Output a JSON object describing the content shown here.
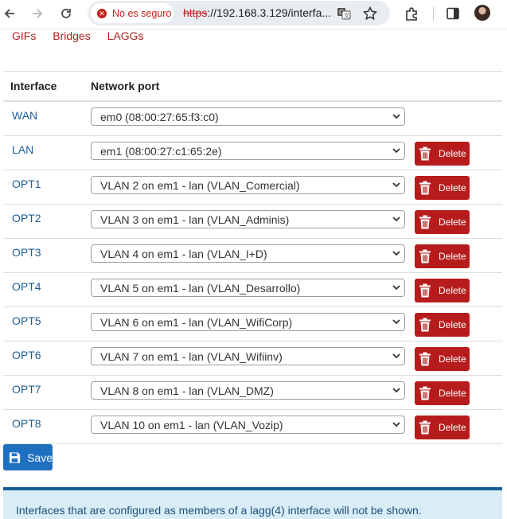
{
  "browser": {
    "security_label": "No es seguro",
    "url_scheme": "https",
    "url_rest": "://192.168.3.129/interfa..."
  },
  "subtabs": [
    "GIFs",
    "Bridges",
    "LAGGs"
  ],
  "table": {
    "headers": {
      "interface": "Interface",
      "network_port": "Network port"
    },
    "rows": [
      {
        "interface": "WAN",
        "port": "em0 (08:00:27:65:f3:c0)",
        "deletable": false
      },
      {
        "interface": "LAN",
        "port": "em1 (08:00:27:c1:65:2e)",
        "deletable": true
      },
      {
        "interface": "OPT1",
        "port": "VLAN 2 on em1 - lan (VLAN_Comercial)",
        "deletable": true
      },
      {
        "interface": "OPT2",
        "port": "VLAN 3 on em1 - lan (VLAN_Adminis)",
        "deletable": true
      },
      {
        "interface": "OPT3",
        "port": "VLAN 4 on em1 - lan (VLAN_I+D)",
        "deletable": true
      },
      {
        "interface": "OPT4",
        "port": "VLAN 5 on em1 - lan (VLAN_Desarrollo)",
        "deletable": true
      },
      {
        "interface": "OPT5",
        "port": "VLAN 6 on em1 - lan (VLAN_WifiCorp)",
        "deletable": true
      },
      {
        "interface": "OPT6",
        "port": "VLAN 7 on em1 - lan (VLAN_Wifiinv)",
        "deletable": true
      },
      {
        "interface": "OPT7",
        "port": "VLAN 8 on em1 - lan (VLAN_DMZ)",
        "deletable": true
      },
      {
        "interface": "OPT8",
        "port": "VLAN 10 on em1 - lan (VLAN_Vozip)",
        "deletable": true
      }
    ],
    "delete_label": "Delete"
  },
  "save_label": "Save",
  "info_text": "Interfaces that are configured as members of a lagg(4) interface will not be shown.",
  "colors": {
    "link": "#1a5e99",
    "tab_link": "#b22222",
    "delete_button": "#b71c1c",
    "save_button": "#1e6fc0",
    "info_background": "#d9edf7"
  }
}
